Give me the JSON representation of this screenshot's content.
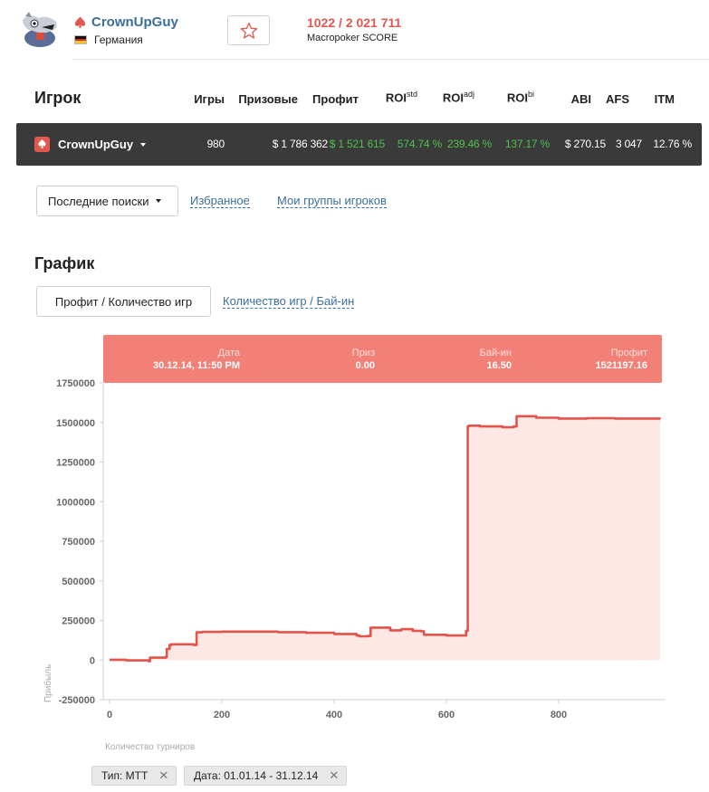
{
  "player": {
    "name": "CrownUpGuy",
    "country": "Германия",
    "score_value": "1022 / 2 021 711",
    "score_label": "Macropoker SCORE"
  },
  "stats": {
    "section_title": "Игрок",
    "headers": {
      "games": "Игры",
      "prize": "Призовые",
      "profit": "Профит",
      "roi_std": "ROI",
      "roi_std_sup": "std",
      "roi_adj": "ROI",
      "roi_adj_sup": "adj",
      "roi_bi": "ROI",
      "roi_bi_sup": "bi",
      "abi": "ABI",
      "afs": "AFS",
      "itm": "ITM"
    },
    "row": {
      "name": "CrownUpGuy",
      "games": "980",
      "prize": "$ 1 786 362",
      "profit": "$ 1 521 615",
      "roi_std": "574.74 %",
      "roi_adj": "239.46 %",
      "roi_bi": "137.17 %",
      "abi": "$ 270.15",
      "afs": "3 047",
      "itm": "12.76 %"
    }
  },
  "filters": {
    "dropdown_label": "Последние поиски",
    "favorites_link": "Избранное",
    "groups_link": "Мои группы игроков"
  },
  "chart_section": {
    "title": "График",
    "active_tab": "Профит / Количество игр",
    "other_tab": "Количество игр / Бай-ин"
  },
  "tooltip": {
    "date_label": "Дата",
    "date_value": "30.12.14, 11:50 PM",
    "prize_label": "Приз",
    "prize_value": "0.00",
    "buyin_label": "Бай-ин",
    "buyin_value": "16.50",
    "profit_label": "Профит",
    "profit_value": "1521197.16"
  },
  "tags": {
    "type": "Тип: МТТ",
    "date": "Дата: 01.01.14 - 31.12.14"
  },
  "colors": {
    "accent": "#e0584f",
    "line": "#e4534a",
    "fill": "#fde8e6",
    "positive": "#4cc24c",
    "link": "#3a6f9c"
  },
  "chart_data": {
    "type": "area",
    "title": "",
    "xlabel": "Количество турниров",
    "ylabel": "Прибыль",
    "xlim": [
      0,
      990
    ],
    "ylim": [
      -250000,
      1750000
    ],
    "x_ticks": [
      0,
      200,
      400,
      600,
      800
    ],
    "y_ticks": [
      -250000,
      0,
      250000,
      500000,
      750000,
      1000000,
      1250000,
      1500000,
      1750000
    ],
    "grid": false,
    "legend": "none",
    "series": [
      {
        "x": [
          0,
          30,
          70,
          72,
          100,
          102,
          107,
          110,
          150,
          155,
          165,
          200,
          260,
          300,
          350,
          400,
          440,
          445,
          460,
          465,
          480,
          500,
          520,
          540,
          555,
          560,
          600,
          630,
          635,
          638,
          640,
          660,
          700,
          720,
          725,
          760,
          800,
          850,
          900,
          980
        ],
        "y": [
          2000,
          -2000,
          -8000,
          15000,
          20000,
          70000,
          95000,
          100000,
          95000,
          175000,
          178000,
          180000,
          180000,
          176000,
          172000,
          165000,
          155000,
          150000,
          152000,
          205000,
          205000,
          188000,
          195000,
          185000,
          182000,
          160000,
          155000,
          155000,
          185000,
          1475000,
          1480000,
          1475000,
          1470000,
          1475000,
          1540000,
          1530000,
          1525000,
          1527000,
          1525000,
          1521197
        ]
      }
    ]
  }
}
